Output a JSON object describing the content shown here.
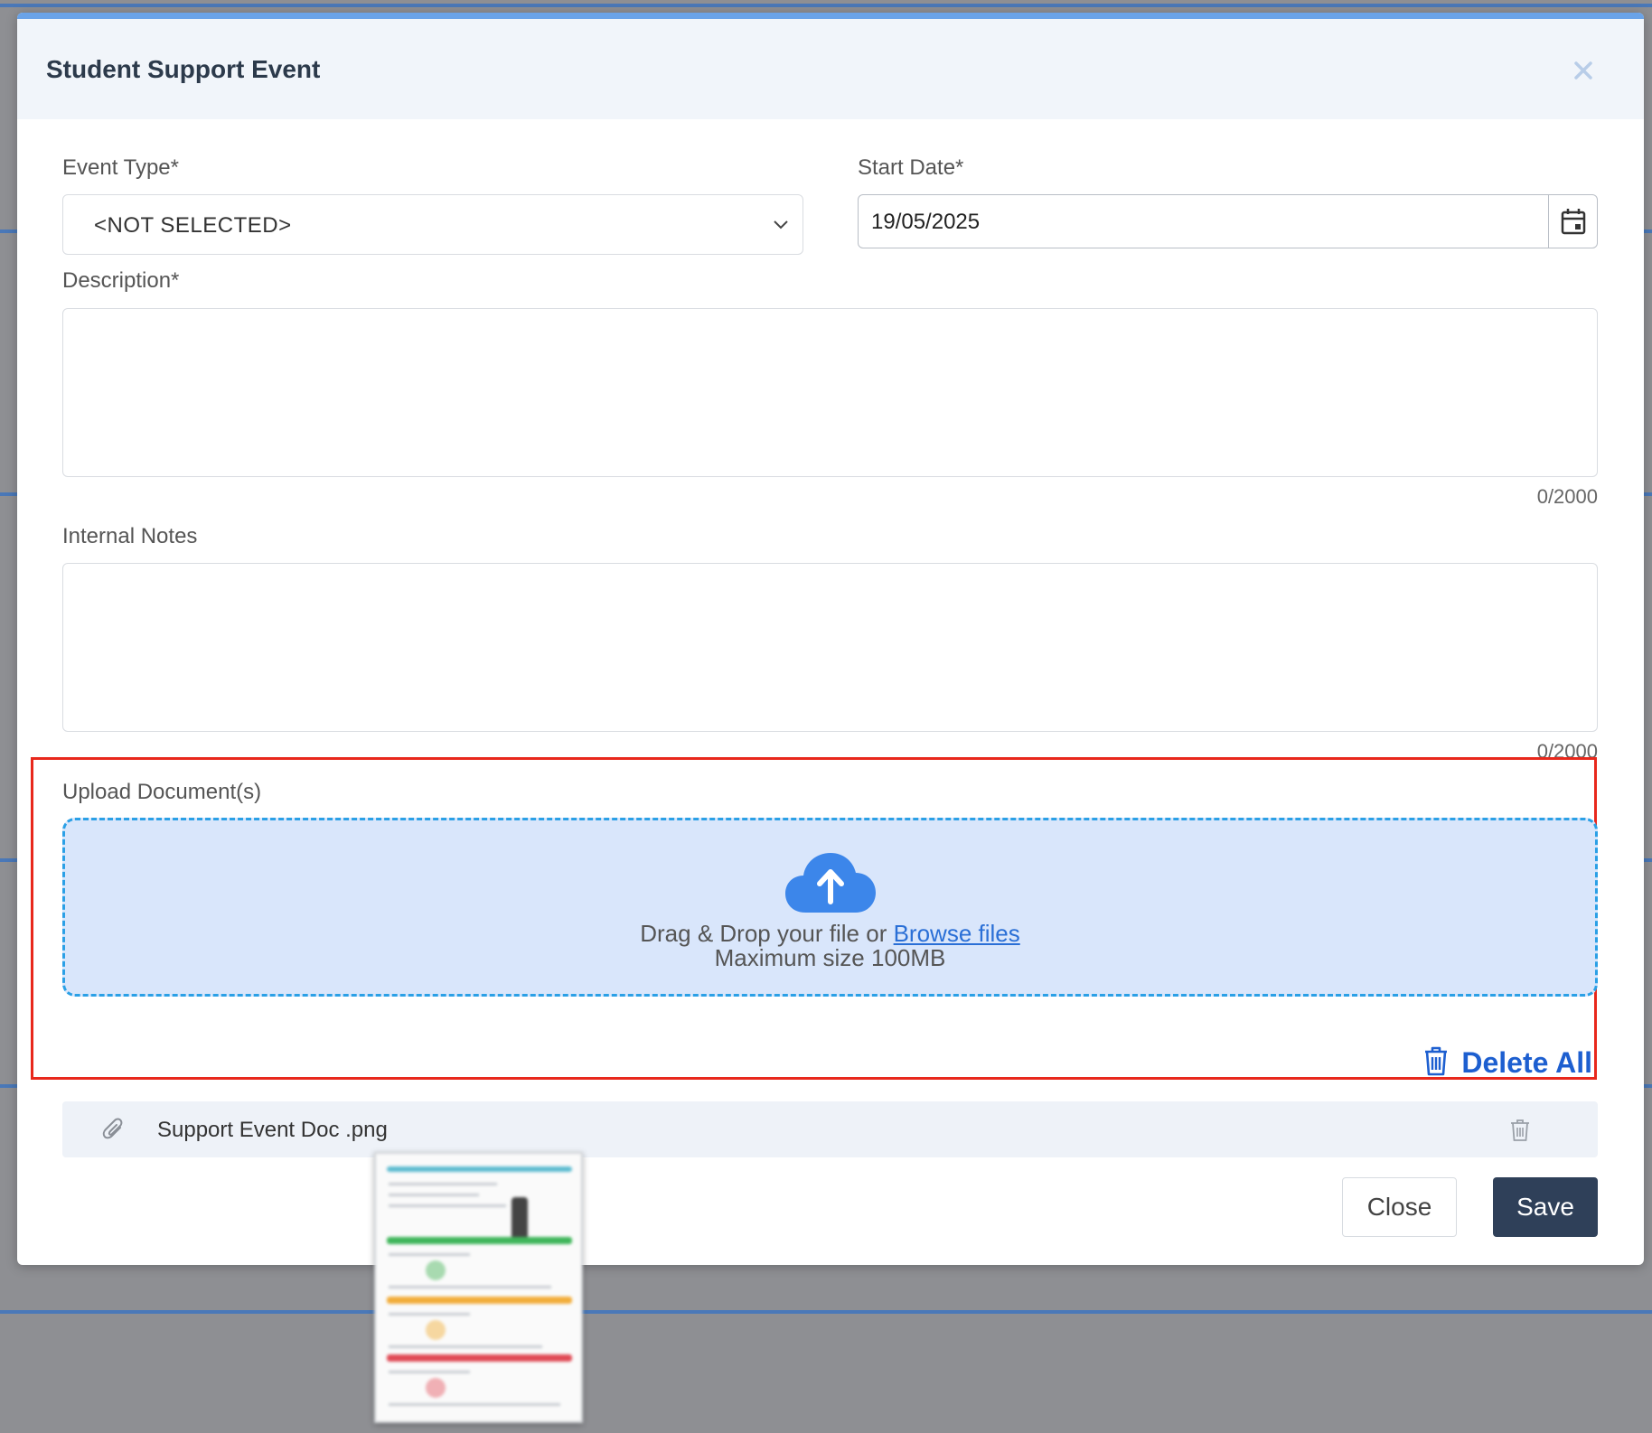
{
  "modal": {
    "title": "Student Support Event",
    "close_icon": "close-icon"
  },
  "form": {
    "event_type": {
      "label": "Event Type*",
      "selected": "<NOT SELECTED>"
    },
    "start_date": {
      "label": "Start Date*",
      "value": "19/05/2025",
      "icon": "calendar-icon"
    },
    "description": {
      "label": "Description*",
      "value": "",
      "counter": "0/2000"
    },
    "internal_notes": {
      "label": "Internal Notes",
      "value": "",
      "counter": "0/2000"
    }
  },
  "upload": {
    "label": "Upload Document(s)",
    "drop_text": "Drag & Drop your file or",
    "browse_link": "Browse files",
    "max_size": "Maximum size 100MB",
    "delete_all_label": "Delete All",
    "files": [
      {
        "name": "Support Event Doc .png"
      }
    ]
  },
  "footer": {
    "close_label": "Close",
    "save_label": "Save"
  },
  "colors": {
    "accent": "#2f4059",
    "link": "#2a6fd6",
    "delete": "#1d5fd0",
    "dropzone_bg": "#d9e6fb",
    "dropzone_border": "#2ba0e6",
    "highlight_frame": "#e8281c"
  }
}
